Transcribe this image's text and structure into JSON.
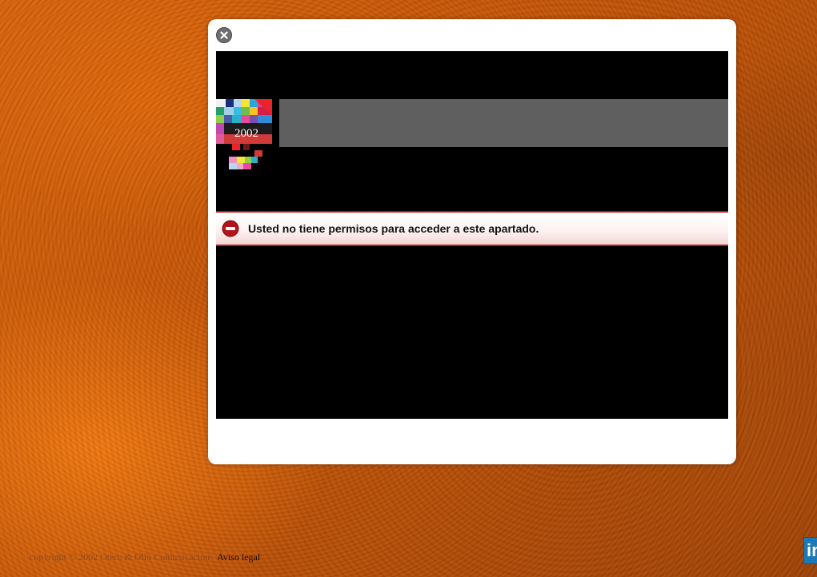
{
  "error": {
    "message": "Usted no tiene permisos para acceder a este apartado."
  },
  "logo": {
    "text": "2002"
  },
  "footer": {
    "copyright": "copyright © 2002 Otero & Ollo Comunicación",
    "legal_link": "Aviso legal"
  },
  "social": {
    "linkedin_label": "in",
    "linkedin_color": "#1b7bb6"
  },
  "icons": {
    "close": "close-icon",
    "error": "no-entry-icon"
  },
  "colors": {
    "error_border": "#c01b1b",
    "header_bar": "#5f5f60",
    "frame_bg": "#000000"
  }
}
